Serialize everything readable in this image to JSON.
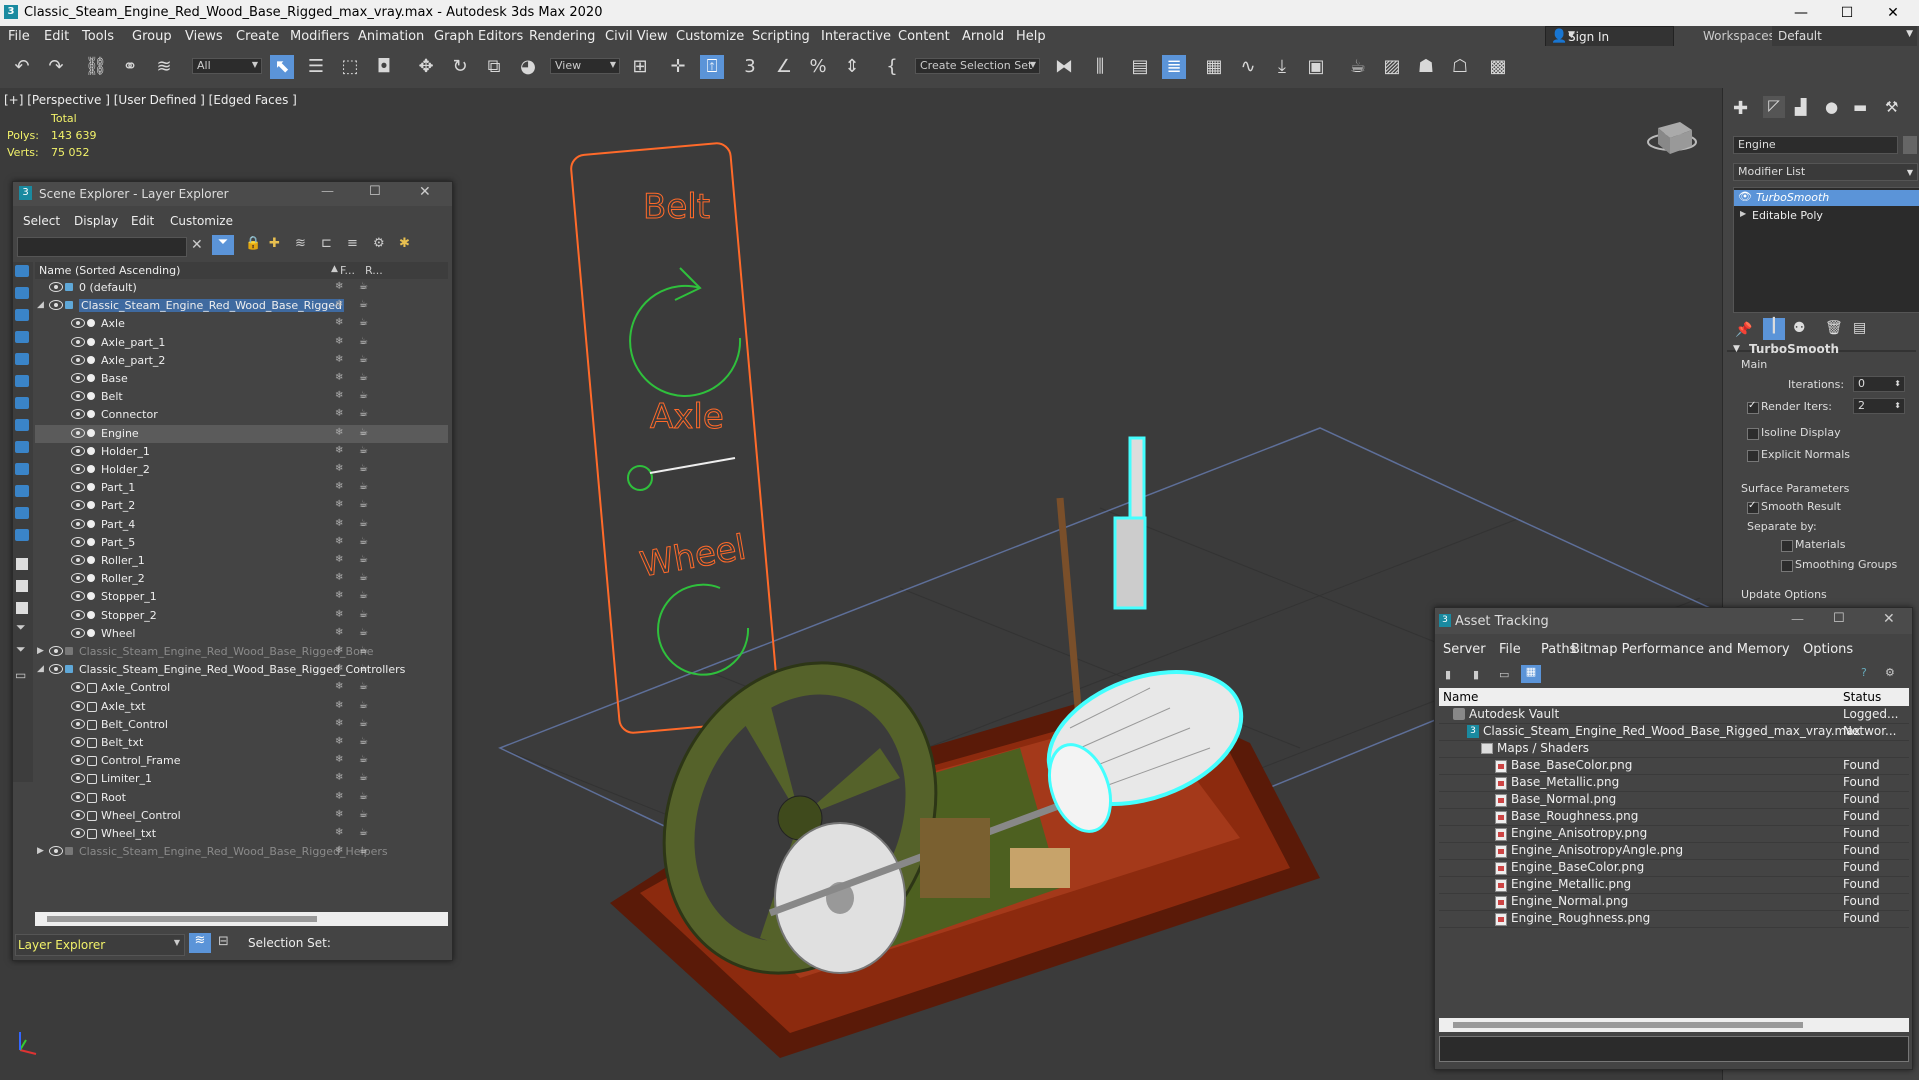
{
  "window": {
    "title": "Classic_Steam_Engine_Red_Wood_Base_Rigged_max_vray.max - Autodesk 3ds Max 2020",
    "minimize": "—",
    "maximize": "☐",
    "close": "✕"
  },
  "menubar": {
    "items": [
      "File",
      "Edit",
      "Tools",
      "Group",
      "Views",
      "Create",
      "Modifiers",
      "Animation",
      "Graph Editors",
      "Rendering",
      "Civil View",
      "Customize",
      "Scripting",
      "Interactive",
      "Content",
      "Arnold",
      "Help"
    ],
    "sign_in": "Sign In",
    "workspaces_label": "Workspaces:",
    "workspace_value": "Default"
  },
  "toolbar": {
    "filter_value": "All",
    "view_value": "View",
    "selection_set_placeholder": "Create Selection Set"
  },
  "viewport": {
    "label": "[+] [Perspective ] [User Defined ] [Edged Faces ]",
    "stats_header": "Total",
    "polys_label": "Polys:",
    "polys_value": "143 639",
    "verts_label": "Verts:",
    "verts_value": "75 052",
    "control_labels": [
      "Belt",
      "Axle",
      "Wheel"
    ]
  },
  "scene_explorer": {
    "title": "Scene Explorer - Layer Explorer",
    "menus": [
      "Select",
      "Display",
      "Edit",
      "Customize"
    ],
    "column_name": "Name (Sorted Ascending)",
    "column_f": "F...",
    "column_r": "R...",
    "rows": [
      {
        "label": "0 (default)",
        "indent": 0,
        "type": "layer",
        "dim": false,
        "selected": false
      },
      {
        "label": "Classic_Steam_Engine_Red_Wood_Base_Rigged",
        "indent": 0,
        "type": "layer-open",
        "dim": false,
        "selected": false,
        "highlight": true
      },
      {
        "label": "Axle",
        "indent": 1,
        "type": "obj",
        "dim": false,
        "selected": false
      },
      {
        "label": "Axle_part_1",
        "indent": 1,
        "type": "obj",
        "dim": false,
        "selected": false
      },
      {
        "label": "Axle_part_2",
        "indent": 1,
        "type": "obj",
        "dim": false,
        "selected": false
      },
      {
        "label": "Base",
        "indent": 1,
        "type": "obj",
        "dim": false,
        "selected": false
      },
      {
        "label": "Belt",
        "indent": 1,
        "type": "obj",
        "dim": false,
        "selected": false
      },
      {
        "label": "Connector",
        "indent": 1,
        "type": "obj",
        "dim": false,
        "selected": false
      },
      {
        "label": "Engine",
        "indent": 1,
        "type": "obj",
        "dim": false,
        "selected": true
      },
      {
        "label": "Holder_1",
        "indent": 1,
        "type": "obj",
        "dim": false,
        "selected": false
      },
      {
        "label": "Holder_2",
        "indent": 1,
        "type": "obj",
        "dim": false,
        "selected": false
      },
      {
        "label": "Part_1",
        "indent": 1,
        "type": "obj",
        "dim": false,
        "selected": false
      },
      {
        "label": "Part_2",
        "indent": 1,
        "type": "obj",
        "dim": false,
        "selected": false
      },
      {
        "label": "Part_4",
        "indent": 1,
        "type": "obj",
        "dim": false,
        "selected": false
      },
      {
        "label": "Part_5",
        "indent": 1,
        "type": "obj",
        "dim": false,
        "selected": false
      },
      {
        "label": "Roller_1",
        "indent": 1,
        "type": "obj",
        "dim": false,
        "selected": false
      },
      {
        "label": "Roller_2",
        "indent": 1,
        "type": "obj",
        "dim": false,
        "selected": false
      },
      {
        "label": "Stopper_1",
        "indent": 1,
        "type": "obj",
        "dim": false,
        "selected": false
      },
      {
        "label": "Stopper_2",
        "indent": 1,
        "type": "obj",
        "dim": false,
        "selected": false
      },
      {
        "label": "Wheel",
        "indent": 1,
        "type": "obj",
        "dim": false,
        "selected": false
      },
      {
        "label": "Classic_Steam_Engine_Red_Wood_Base_Rigged_Bone",
        "indent": 0,
        "type": "layer-closed",
        "dim": true,
        "selected": false
      },
      {
        "label": "Classic_Steam_Engine_Red_Wood_Base_Rigged_Controllers",
        "indent": 0,
        "type": "layer-open",
        "dim": false,
        "selected": false
      },
      {
        "label": "Axle_Control",
        "indent": 1,
        "type": "shape",
        "dim": false,
        "selected": false
      },
      {
        "label": "Axle_txt",
        "indent": 1,
        "type": "shape",
        "dim": false,
        "selected": false
      },
      {
        "label": "Belt_Control",
        "indent": 1,
        "type": "shape",
        "dim": false,
        "selected": false
      },
      {
        "label": "Belt_txt",
        "indent": 1,
        "type": "shape",
        "dim": false,
        "selected": false
      },
      {
        "label": "Control_Frame",
        "indent": 1,
        "type": "shape",
        "dim": false,
        "selected": false
      },
      {
        "label": "Limiter_1",
        "indent": 1,
        "type": "shape",
        "dim": false,
        "selected": false
      },
      {
        "label": "Root",
        "indent": 1,
        "type": "shape",
        "dim": false,
        "selected": false
      },
      {
        "label": "Wheel_Control",
        "indent": 1,
        "type": "shape",
        "dim": false,
        "selected": false
      },
      {
        "label": "Wheel_txt",
        "indent": 1,
        "type": "shape",
        "dim": false,
        "selected": false
      },
      {
        "label": "Classic_Steam_Engine_Red_Wood_Base_Rigged_Helpers",
        "indent": 0,
        "type": "layer-closed",
        "dim": true,
        "selected": false
      }
    ],
    "footer_layer": "Layer Explorer",
    "footer_selection": "Selection Set:"
  },
  "command_panel": {
    "object_name": "Engine",
    "modifier_list": "Modifier List",
    "stack": [
      "TurboSmooth",
      "Editable Poly"
    ],
    "rollout_title": "TurboSmooth",
    "main_label": "Main",
    "iterations_label": "Iterations:",
    "iterations_value": "0",
    "render_iters_label": "Render Iters:",
    "render_iters_value": "2",
    "isoline_display": "Isoline Display",
    "explicit_normals": "Explicit Normals",
    "surface_params": "Surface Parameters",
    "smooth_result": "Smooth Result",
    "separate_by": "Separate by:",
    "materials": "Materials",
    "smoothing_groups": "Smoothing Groups",
    "update_options": "Update Options"
  },
  "asset_tracking": {
    "title": "Asset Tracking",
    "menus": [
      "Server",
      "File",
      "Paths",
      "Bitmap Performance and Memory",
      "Options"
    ],
    "col_name": "Name",
    "col_status": "Status",
    "rows": [
      {
        "name": "Autodesk Vault",
        "status": "Logged...",
        "indent": 0,
        "icon": "vault"
      },
      {
        "name": "Classic_Steam_Engine_Red_Wood_Base_Rigged_max_vray.max",
        "status": "Networ...",
        "indent": 1,
        "icon": "max"
      },
      {
        "name": "Maps / Shaders",
        "status": "",
        "indent": 2,
        "icon": "folder"
      },
      {
        "name": "Base_BaseColor.png",
        "status": "Found",
        "indent": 3,
        "icon": "file"
      },
      {
        "name": "Base_Metallic.png",
        "status": "Found",
        "indent": 3,
        "icon": "file"
      },
      {
        "name": "Base_Normal.png",
        "status": "Found",
        "indent": 3,
        "icon": "file"
      },
      {
        "name": "Base_Roughness.png",
        "status": "Found",
        "indent": 3,
        "icon": "file"
      },
      {
        "name": "Engine_Anisotropy.png",
        "status": "Found",
        "indent": 3,
        "icon": "file"
      },
      {
        "name": "Engine_AnisotropyAngle.png",
        "status": "Found",
        "indent": 3,
        "icon": "file"
      },
      {
        "name": "Engine_BaseColor.png",
        "status": "Found",
        "indent": 3,
        "icon": "file"
      },
      {
        "name": "Engine_Metallic.png",
        "status": "Found",
        "indent": 3,
        "icon": "file"
      },
      {
        "name": "Engine_Normal.png",
        "status": "Found",
        "indent": 3,
        "icon": "file"
      },
      {
        "name": "Engine_Roughness.png",
        "status": "Found",
        "indent": 3,
        "icon": "file"
      }
    ]
  }
}
